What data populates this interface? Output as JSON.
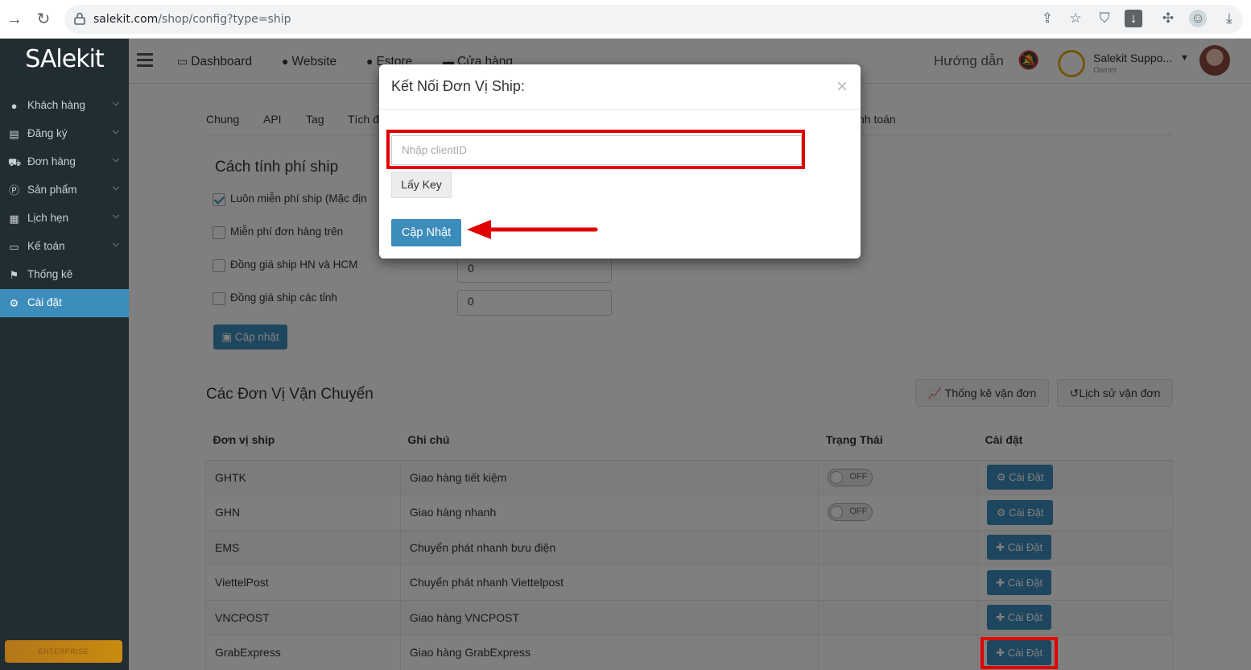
{
  "browser": {
    "url_domain": "salekit.com",
    "url_path": "/shop/config?type=ship"
  },
  "sidebar": {
    "logo": "SAlekit",
    "items": [
      {
        "label": "Khách hàng",
        "icon": "user-icon",
        "caret": true
      },
      {
        "label": "Đăng ký",
        "icon": "list-icon",
        "caret": true
      },
      {
        "label": "Đơn hàng",
        "icon": "cart-icon",
        "caret": true
      },
      {
        "label": "Sản phẩm",
        "icon": "product-icon",
        "caret": true
      },
      {
        "label": "Lịch hẹn",
        "icon": "calendar-icon",
        "caret": true
      },
      {
        "label": "Kế toán",
        "icon": "card-icon",
        "caret": true
      },
      {
        "label": "Thống kê",
        "icon": "flag-icon",
        "caret": false
      },
      {
        "label": "Cài đặt",
        "icon": "gear-icon",
        "caret": false,
        "active": true
      }
    ],
    "enterprise_badge": "ENTERPRISE"
  },
  "topbar": {
    "links": [
      "Dashboard",
      "Website",
      "Estore",
      "Cửa hàng"
    ],
    "help": "Hướng dẫn",
    "account_name": "Salekit Suppo...",
    "account_role": "Owner"
  },
  "tabs": [
    "Chung",
    "API",
    "Tag",
    "Tích đ",
    "nh toán"
  ],
  "shipping_fee": {
    "title": "Cách tính phí ship",
    "options": [
      {
        "label": "Luôn miễn phí ship (Mặc địn",
        "checked": true
      },
      {
        "label": "Miễn phí đơn hàng trên",
        "checked": false
      },
      {
        "label": "Đồng giá ship HN và HCM",
        "checked": false,
        "value": "0"
      },
      {
        "label": "Đồng giá ship các tỉnh",
        "checked": false,
        "value": "0"
      }
    ],
    "update_button": "Cập nhật"
  },
  "carriers": {
    "title": "Các Đơn Vị Vận Chuyển",
    "stats_button": "Thống kê vận đơn",
    "history_button": "Lịch sử vận đơn",
    "columns": [
      "Đơn vị ship",
      "Ghi chú",
      "Trạng Thái",
      "Cài đặt"
    ],
    "rows": [
      {
        "name": "GHTK",
        "note": "Giao hàng tiết kiệm",
        "status": "OFF",
        "action": "Cài Đặt",
        "icon": "gear"
      },
      {
        "name": "GHN",
        "note": "Giao hàng nhanh",
        "status": "OFF",
        "action": "Cài Đặt",
        "icon": "gear"
      },
      {
        "name": "EMS",
        "note": "Chuyển phát nhanh bưu điện",
        "status": "",
        "action": "Cài Đặt",
        "icon": "plus"
      },
      {
        "name": "ViettelPost",
        "note": "Chuyển phát nhanh Viettelpost",
        "status": "",
        "action": "Cài Đặt",
        "icon": "plus"
      },
      {
        "name": "VNCPOST",
        "note": "Giao hàng VNCPOST",
        "status": "",
        "action": "Cài Đặt",
        "icon": "plus"
      },
      {
        "name": "GrabExpress",
        "note": "Giao hàng GrabExpress",
        "status": "",
        "action": "Cài Đặt",
        "icon": "plus"
      }
    ]
  },
  "modal": {
    "title": "Kết Nối Đơn Vị Ship:",
    "client_placeholder": "Nhập clientID",
    "get_key_button": "Lấy Key",
    "submit_button": "Cập Nhật"
  },
  "colors": {
    "primary": "#3c8dbc",
    "sidebar_bg": "#222d32",
    "highlight": "#e00000"
  }
}
